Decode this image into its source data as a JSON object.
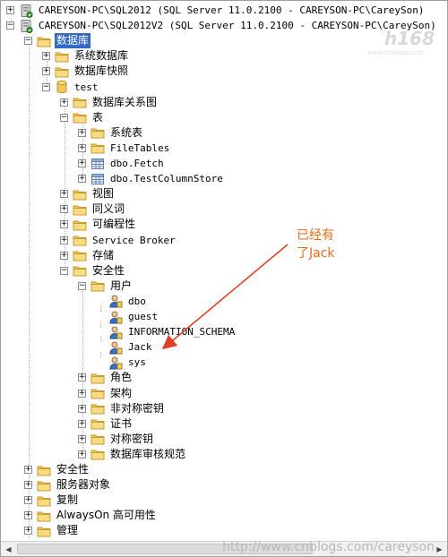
{
  "tree": [
    {
      "label": "CAREYSON-PC\\SQL2012 (SQL Server 11.0.2100 - CAREYSON-PC\\CareySon)",
      "level": 0,
      "exp": "+",
      "icon": "server-icon",
      "cn": false
    },
    {
      "label": "CAREYSON-PC\\SQL2012V2 (SQL Server 11.0.2100 - CAREYSON-PC\\CareySon)",
      "level": 0,
      "exp": "-",
      "icon": "server-icon",
      "cn": false
    },
    {
      "label": "数据库",
      "level": 1,
      "exp": "-",
      "icon": "folder-icon",
      "cn": true,
      "selected": true
    },
    {
      "label": "系统数据库",
      "level": 2,
      "exp": "+",
      "icon": "folder-icon",
      "cn": true
    },
    {
      "label": "数据库快照",
      "level": 2,
      "exp": "+",
      "icon": "folder-icon",
      "cn": true
    },
    {
      "label": "test",
      "level": 2,
      "exp": "-",
      "icon": "database-icon",
      "cn": false
    },
    {
      "label": "数据库关系图",
      "level": 3,
      "exp": "+",
      "icon": "folder-icon",
      "cn": true
    },
    {
      "label": "表",
      "level": 3,
      "exp": "-",
      "icon": "folder-icon",
      "cn": true
    },
    {
      "label": "系统表",
      "level": 4,
      "exp": "+",
      "icon": "folder-icon",
      "cn": true
    },
    {
      "label": "FileTables",
      "level": 4,
      "exp": "+",
      "icon": "folder-icon",
      "cn": false
    },
    {
      "label": "dbo.Fetch",
      "level": 4,
      "exp": "+",
      "icon": "table-icon",
      "cn": false
    },
    {
      "label": "dbo.TestColumnStore",
      "level": 4,
      "exp": "+",
      "icon": "table-icon",
      "cn": false
    },
    {
      "label": "视图",
      "level": 3,
      "exp": "+",
      "icon": "folder-icon",
      "cn": true
    },
    {
      "label": "同义词",
      "level": 3,
      "exp": "+",
      "icon": "folder-icon",
      "cn": true
    },
    {
      "label": "可编程性",
      "level": 3,
      "exp": "+",
      "icon": "folder-icon",
      "cn": true
    },
    {
      "label": "Service Broker",
      "level": 3,
      "exp": "+",
      "icon": "folder-icon",
      "cn": false
    },
    {
      "label": "存储",
      "level": 3,
      "exp": "+",
      "icon": "folder-icon",
      "cn": true
    },
    {
      "label": "安全性",
      "level": 3,
      "exp": "-",
      "icon": "folder-icon",
      "cn": true
    },
    {
      "label": "用户",
      "level": 4,
      "exp": "-",
      "icon": "folder-icon",
      "cn": true
    },
    {
      "label": "dbo",
      "level": 5,
      "exp": "",
      "icon": "user-icon",
      "cn": false
    },
    {
      "label": "guest",
      "level": 5,
      "exp": "",
      "icon": "user-icon",
      "cn": false
    },
    {
      "label": "INFORMATION_SCHEMA",
      "level": 5,
      "exp": "",
      "icon": "user-icon",
      "cn": false
    },
    {
      "label": "Jack",
      "level": 5,
      "exp": "",
      "icon": "user-icon",
      "cn": false
    },
    {
      "label": "sys",
      "level": 5,
      "exp": "",
      "icon": "user-icon",
      "cn": false
    },
    {
      "label": "角色",
      "level": 4,
      "exp": "+",
      "icon": "folder-icon",
      "cn": true
    },
    {
      "label": "架构",
      "level": 4,
      "exp": "+",
      "icon": "folder-icon",
      "cn": true
    },
    {
      "label": "非对称密钥",
      "level": 4,
      "exp": "+",
      "icon": "folder-icon",
      "cn": true
    },
    {
      "label": "证书",
      "level": 4,
      "exp": "+",
      "icon": "folder-icon",
      "cn": true
    },
    {
      "label": "对称密钥",
      "level": 4,
      "exp": "+",
      "icon": "folder-icon",
      "cn": true
    },
    {
      "label": "数据库审核规范",
      "level": 4,
      "exp": "+",
      "icon": "folder-icon",
      "cn": true
    },
    {
      "label": "安全性",
      "level": 1,
      "exp": "+",
      "icon": "folder-icon",
      "cn": true
    },
    {
      "label": "服务器对象",
      "level": 1,
      "exp": "+",
      "icon": "folder-icon",
      "cn": true
    },
    {
      "label": "复制",
      "level": 1,
      "exp": "+",
      "icon": "folder-icon",
      "cn": true
    },
    {
      "label": "AlwaysOn 高可用性",
      "level": 1,
      "exp": "+",
      "icon": "folder-icon",
      "cn": true
    },
    {
      "label": "管理",
      "level": 1,
      "exp": "+",
      "icon": "folder-icon",
      "cn": true
    }
  ],
  "annotation": {
    "line1": "已经有",
    "line2": "了Jack"
  },
  "watermark": "http://www.cnblogs.com/careyson",
  "logo": "h168",
  "logo_sub": "www.cnblogs.com",
  "colors": {
    "selected_bg": "#316ac5",
    "annotation": "#e86b1a",
    "folder": "#f5d36b"
  }
}
